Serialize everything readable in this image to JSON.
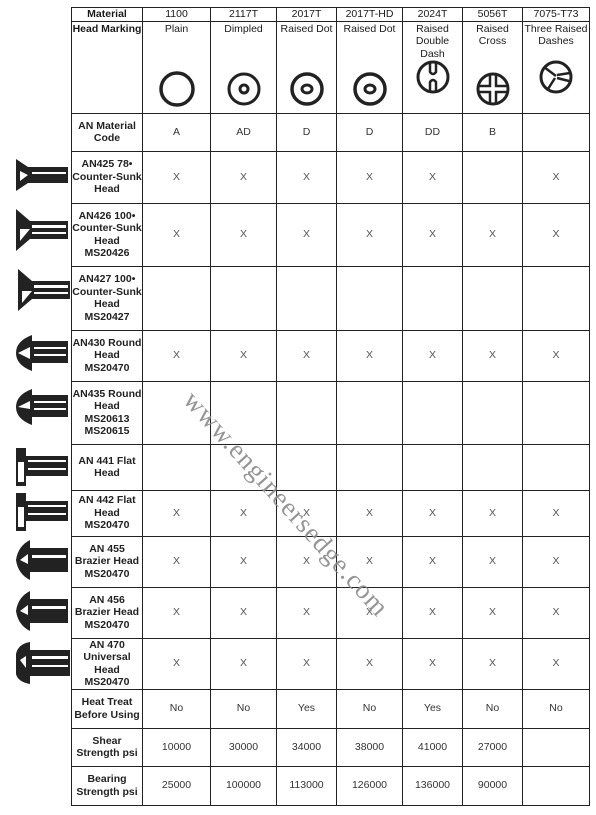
{
  "table": {
    "material_label": "Material",
    "materials": [
      "1100",
      "2117T",
      "2017T",
      "2017T-HD",
      "2024T",
      "5056T",
      "7075-T73"
    ],
    "head_marking_label": "Head Marking",
    "head_markings": [
      {
        "name": "Plain",
        "icon": "plain-circle-icon"
      },
      {
        "name": "Dimpled",
        "icon": "dimpled-icon"
      },
      {
        "name": "Raised Dot",
        "icon": "raised-dot-icon"
      },
      {
        "name": "Raised Dot",
        "icon": "raised-dot-icon"
      },
      {
        "name": "Raised Double Dash",
        "icon": "raised-double-dash-icon"
      },
      {
        "name": "Raised Cross",
        "icon": "raised-cross-icon"
      },
      {
        "name": "Three Raised Dashes",
        "icon": "three-raised-dashes-icon"
      }
    ],
    "material_code_label": "AN Material Code",
    "material_codes": [
      "A",
      "AD",
      "D",
      "D",
      "DD",
      "B",
      ""
    ],
    "rivet_rows": [
      {
        "label": "AN425 78• Counter-Sunk Head",
        "icon": "countersunk-rivet-icon",
        "cells": [
          "X",
          "X",
          "X",
          "X",
          "X",
          "",
          "X"
        ]
      },
      {
        "label": "AN426 100• Counter-Sunk Head MS20426",
        "icon": "countersunk-rivet-icon",
        "cells": [
          "X",
          "X",
          "X",
          "X",
          "X",
          "X",
          "X"
        ]
      },
      {
        "label": "AN427 100• Counter-Sunk Head MS20427",
        "icon": "countersunk-rivet-icon",
        "cells": [
          "",
          "",
          "",
          "",
          "",
          "",
          ""
        ]
      },
      {
        "label": "AN430 Round Head MS20470",
        "icon": "round-head-rivet-icon",
        "cells": [
          "X",
          "X",
          "X",
          "X",
          "X",
          "X",
          "X"
        ]
      },
      {
        "label": "AN435 Round Head MS20613 MS20615",
        "icon": "round-head-rivet-icon",
        "cells": [
          "",
          "",
          "",
          "",
          "",
          "",
          ""
        ]
      },
      {
        "label": "AN 441 Flat Head",
        "icon": "flat-head-rivet-icon",
        "cells": [
          "",
          "",
          "",
          "",
          "",
          "",
          ""
        ]
      },
      {
        "label": "AN 442 Flat Head MS20470",
        "icon": "flat-head-rivet-icon",
        "cells": [
          "X",
          "X",
          "X",
          "X",
          "X",
          "X",
          "X"
        ]
      },
      {
        "label": "AN 455 Brazier Head MS20470",
        "icon": "brazier-head-rivet-icon",
        "cells": [
          "X",
          "X",
          "X",
          "X",
          "X",
          "X",
          "X"
        ]
      },
      {
        "label": "AN 456 Brazier Head MS20470",
        "icon": "brazier-head-rivet-icon",
        "cells": [
          "X",
          "X",
          "X",
          "X",
          "X",
          "X",
          "X"
        ]
      },
      {
        "label": "AN 470 Universal Head MS20470",
        "icon": "universal-head-rivet-icon",
        "cells": [
          "X",
          "X",
          "X",
          "X",
          "X",
          "X",
          "X"
        ]
      }
    ],
    "heat_treat_label": "Heat Treat Before Using",
    "heat_treat": [
      "No",
      "No",
      "Yes",
      "No",
      "Yes",
      "No",
      "No"
    ],
    "shear_label": "Shear Strength psi",
    "shear": [
      "10000",
      "30000",
      "34000",
      "38000",
      "41000",
      "27000",
      ""
    ],
    "bearing_label": "Bearing Strength psi",
    "bearing": [
      "25000",
      "100000",
      "113000",
      "126000",
      "136000",
      "90000",
      ""
    ]
  },
  "watermark": "www.engineersedge.com"
}
